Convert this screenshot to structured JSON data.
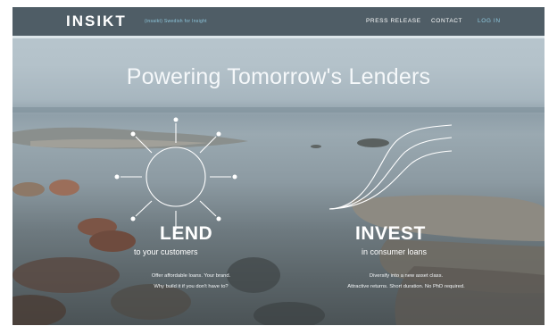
{
  "brand": {
    "logo": "INSIKT",
    "tagline": "(insaikt) Swedish for Insight"
  },
  "nav": {
    "items": [
      {
        "label": "PRESS RELEASE"
      },
      {
        "label": "CONTACT"
      },
      {
        "label": "LOG IN"
      }
    ]
  },
  "hero": {
    "title": "Powering Tomorrow's Lenders"
  },
  "lend": {
    "title": "LEND",
    "subtitle": "to your customers",
    "line1": "Offer affordable loans. Your brand.",
    "line2": "Why build it if you don't have to?"
  },
  "invest": {
    "title": "INVEST",
    "subtitle": "in consumer loans",
    "line1": "Diversify into a new asset class.",
    "line2": "Attractive returns. Short duration. No PhD required."
  },
  "colors": {
    "header": "#4f5d66",
    "accent": "#8ec8de",
    "text": "#ffffff"
  }
}
